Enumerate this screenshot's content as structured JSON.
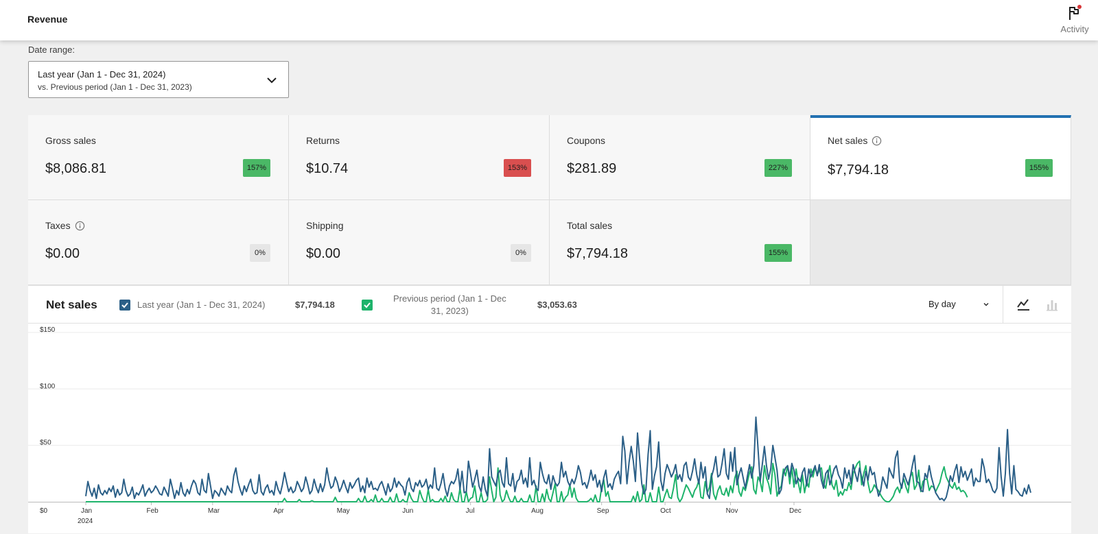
{
  "header": {
    "title": "Revenue",
    "activity_label": "Activity"
  },
  "date_range": {
    "label": "Date range:",
    "primary": "Last year (Jan 1 - Dec 31, 2024)",
    "secondary": "vs. Previous period (Jan 1 - Dec 31, 2023)"
  },
  "tiles": [
    {
      "label": "Gross sales",
      "value": "$8,086.81",
      "delta": "157%",
      "trend": "up"
    },
    {
      "label": "Returns",
      "value": "$10.74",
      "delta": "153%",
      "trend": "down"
    },
    {
      "label": "Coupons",
      "value": "$281.89",
      "delta": "227%",
      "trend": "up"
    },
    {
      "label": "Net sales",
      "value": "$7,794.18",
      "delta": "155%",
      "trend": "up",
      "selected": true
    },
    {
      "label": "Taxes",
      "value": "$0.00",
      "delta": "0%",
      "trend": "flat"
    },
    {
      "label": "Shipping",
      "value": "$0.00",
      "delta": "0%",
      "trend": "flat"
    },
    {
      "label": "Total sales",
      "value": "$7,794.18",
      "delta": "155%",
      "trend": "up"
    }
  ],
  "chart_panel": {
    "title": "Net sales",
    "legend": [
      {
        "label": "Last year (Jan 1 - Dec 31, 2024)",
        "total": "$7,794.18",
        "color": "#2b5f87",
        "checked": true
      },
      {
        "label_line1": "Previous period (Jan 1 - Dec",
        "label_line2": "31, 2023)",
        "total": "$3,053.63",
        "color": "#1eb36b",
        "checked": true
      }
    ],
    "interval": "By day",
    "modes": [
      "line-chart-icon",
      "bar-chart-icon"
    ]
  },
  "chart_data": {
    "type": "line",
    "title": "",
    "xlabel": "",
    "ylabel": "",
    "ylim": [
      0,
      150
    ],
    "y_ticks": [
      "$0",
      "$50",
      "$100",
      "$150"
    ],
    "x_ticks": [
      "Jan",
      "Feb",
      "Mar",
      "Apr",
      "May",
      "Jun",
      "Jul",
      "Aug",
      "Sep",
      "Oct",
      "Nov",
      "Dec"
    ],
    "x_year_label": "2024",
    "grid": true,
    "series": [
      {
        "name": "Last year (Jan 1 - Dec 31, 2024)",
        "color": "#2b5f87",
        "values": [
          5,
          18,
          10,
          5,
          12,
          3,
          15,
          8,
          6,
          10,
          7,
          12,
          9,
          14,
          4,
          11,
          6,
          8,
          20,
          10,
          5,
          7,
          13,
          3,
          8,
          6,
          10,
          15,
          5,
          9,
          12,
          8,
          10,
          14,
          11,
          7,
          6,
          13,
          9,
          5,
          20,
          12,
          3,
          10,
          6,
          17,
          8,
          5,
          11,
          7,
          14,
          19,
          16,
          8,
          6,
          20,
          10,
          8,
          25,
          14,
          3,
          10,
          8,
          5,
          12,
          9,
          6,
          14,
          10,
          8,
          23,
          30,
          18,
          11,
          6,
          14,
          9,
          15,
          20,
          10,
          7,
          8,
          24,
          9,
          6,
          12,
          15,
          8,
          10,
          6,
          18,
          11,
          7,
          15,
          26,
          17,
          9,
          13,
          8,
          10,
          18,
          14,
          9,
          12,
          22,
          15,
          7,
          10,
          20,
          13,
          8,
          16,
          9,
          15,
          30,
          19,
          12,
          14,
          22,
          17,
          9,
          13,
          19,
          13,
          8,
          17,
          12,
          15,
          19,
          21,
          9,
          14,
          8,
          21,
          13,
          18,
          11,
          12,
          10,
          15,
          18,
          12,
          6,
          16,
          9,
          12,
          21,
          13,
          18,
          15,
          13,
          6,
          17,
          21,
          12,
          9,
          17,
          14,
          19,
          13,
          15,
          20,
          11,
          15,
          12,
          30,
          12,
          10,
          16,
          25,
          12,
          5,
          14,
          18,
          16,
          20,
          29,
          11,
          27,
          8,
          9,
          36,
          25,
          13,
          20,
          28,
          14,
          9,
          22,
          11,
          5,
          47,
          22,
          18,
          14,
          25,
          28,
          17,
          13,
          39,
          16,
          14,
          25,
          9,
          18,
          20,
          28,
          16,
          21,
          13,
          39,
          15,
          19,
          12,
          10,
          35,
          25,
          18,
          16,
          24,
          11,
          23,
          17,
          14,
          17,
          35,
          22,
          27,
          18,
          14,
          20,
          16,
          22,
          32,
          26,
          15,
          17,
          12,
          19,
          28,
          19,
          24,
          13,
          19,
          9,
          21,
          28,
          13,
          16,
          11,
          20,
          24,
          27,
          16,
          58,
          45,
          16,
          35,
          49,
          36,
          18,
          61,
          38,
          16,
          7,
          11,
          42,
          63,
          11,
          23,
          31,
          53,
          19,
          10,
          25,
          33,
          28,
          22,
          26,
          33,
          20,
          24,
          18,
          32,
          35,
          22,
          19,
          27,
          38,
          24,
          16,
          35,
          21,
          31,
          7,
          3,
          22,
          29,
          40,
          22,
          24,
          34,
          47,
          25,
          20,
          44,
          27,
          48,
          15,
          24,
          30,
          21,
          12,
          23,
          33,
          21,
          32,
          75,
          47,
          18,
          33,
          49,
          32,
          20,
          29,
          50,
          39,
          28,
          7,
          11,
          25,
          30,
          32,
          22,
          34,
          28,
          16,
          21,
          18,
          26,
          30,
          14,
          29,
          22,
          27,
          32,
          23,
          33,
          19,
          12,
          25,
          28,
          15,
          22,
          29,
          32,
          24,
          20,
          12,
          30,
          21,
          28,
          16,
          33,
          25,
          18,
          30,
          22,
          14,
          27,
          19,
          31,
          24,
          26,
          14,
          5,
          10,
          22,
          17,
          12,
          30,
          25,
          21,
          39,
          45,
          18,
          12,
          25,
          20,
          15,
          22,
          32,
          41,
          18,
          17,
          10,
          9,
          25,
          21,
          32,
          22,
          15,
          8,
          5,
          2,
          3,
          1,
          4,
          12,
          23,
          18,
          27,
          33,
          17,
          31,
          22,
          27,
          19,
          24,
          29,
          14,
          21,
          18,
          18,
          38,
          30,
          17,
          20,
          16,
          10,
          8,
          12,
          48,
          22,
          5,
          25,
          64,
          25,
          7,
          32,
          11,
          9,
          6,
          5,
          12,
          7,
          15,
          8
        ]
      },
      {
        "name": "Previous period (Jan 1 - Dec 31, 2023)",
        "color": "#1eb36b",
        "values": [
          0,
          0,
          0,
          0,
          0,
          0,
          0,
          0,
          0,
          0,
          0,
          0,
          0,
          0,
          0,
          0,
          0,
          0,
          0,
          0,
          0,
          0,
          0,
          0,
          0,
          0,
          0,
          0,
          0,
          0,
          0,
          0,
          0,
          0,
          0,
          0,
          0,
          0,
          0,
          0,
          0,
          0,
          0,
          0,
          0,
          0,
          0,
          0,
          0,
          0,
          0,
          0,
          0,
          0,
          0,
          0,
          0,
          0,
          0,
          0,
          0,
          0,
          0,
          0,
          0,
          0,
          0,
          0,
          0,
          0,
          0,
          0,
          0,
          0,
          0,
          0,
          0,
          0,
          0,
          0,
          0,
          0,
          0,
          0,
          0,
          0,
          0,
          0,
          0,
          0,
          0,
          0,
          0,
          0,
          3,
          0,
          0,
          0,
          0,
          0,
          0,
          2,
          0,
          0,
          0,
          0,
          0,
          1,
          0,
          0,
          0,
          0,
          0,
          0,
          0,
          0,
          0,
          0,
          4,
          0,
          0,
          0,
          0,
          0,
          0,
          0,
          0,
          0,
          0,
          3,
          0,
          0,
          5,
          0,
          0,
          2,
          0,
          6,
          0,
          0,
          3,
          0,
          0,
          0,
          4,
          0,
          0,
          7,
          0,
          0,
          2,
          0,
          0,
          8,
          3,
          0,
          0,
          0,
          10,
          4,
          0,
          0,
          11,
          0,
          2,
          0,
          0,
          0,
          3,
          0,
          5,
          0,
          0,
          8,
          2,
          0,
          0,
          12,
          0,
          0,
          9,
          0,
          3,
          4,
          14,
          0,
          0,
          8,
          0,
          0,
          2,
          22,
          10,
          0,
          4,
          30,
          6,
          0,
          2,
          10,
          4,
          0,
          0,
          5,
          0,
          0,
          3,
          0,
          0,
          0,
          6,
          0,
          0,
          14,
          0,
          0,
          7,
          0,
          11,
          3,
          0,
          8,
          16,
          0,
          0,
          9,
          0,
          4,
          6,
          15,
          4,
          12,
          3,
          0,
          0,
          0,
          0,
          0,
          1,
          3,
          0,
          6,
          0,
          0,
          13,
          20,
          5,
          9,
          0,
          0,
          0,
          0,
          0,
          0,
          0,
          0,
          0,
          0,
          0,
          5,
          0,
          9,
          0,
          2,
          15,
          0,
          0,
          8,
          0,
          0,
          0,
          13,
          0,
          0,
          6,
          11,
          4,
          3,
          12,
          24,
          4,
          0,
          3,
          9,
          15,
          12,
          8,
          4,
          10,
          13,
          19,
          4,
          3,
          18,
          8,
          13,
          25,
          7,
          2,
          10,
          14,
          7,
          6,
          12,
          5,
          14,
          8,
          21,
          27,
          9,
          5,
          13,
          10,
          18,
          26,
          31,
          11,
          7,
          22,
          18,
          9,
          32,
          21,
          16,
          7,
          34,
          24,
          5,
          11,
          14,
          29,
          23,
          32,
          16,
          30,
          13,
          29,
          17,
          8,
          24,
          8,
          18,
          13,
          29,
          22,
          31,
          24,
          28,
          30,
          16,
          12,
          24,
          32,
          15,
          11,
          19,
          5,
          9,
          6,
          11,
          10,
          17,
          11,
          25,
          30,
          34,
          36,
          15,
          25,
          32,
          17,
          8,
          10,
          15,
          12,
          10,
          6,
          3,
          1,
          0,
          0,
          2,
          5,
          10,
          13,
          8,
          15,
          20,
          13,
          8,
          22,
          26,
          11,
          15,
          28,
          9,
          18,
          20,
          20,
          10,
          14,
          13,
          9,
          13,
          17,
          25,
          31,
          22,
          18,
          14,
          12,
          17,
          11,
          13,
          9,
          10,
          8,
          4
        ]
      }
    ]
  }
}
